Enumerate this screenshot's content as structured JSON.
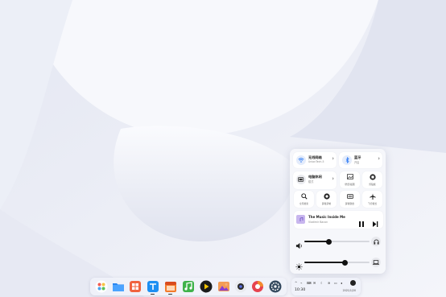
{
  "control_center": {
    "wifi": {
      "title": "无线网络",
      "subtitle": "UnionTech-5"
    },
    "bluetooth": {
      "title": "蓝牙",
      "subtitle": "开启"
    },
    "power": {
      "title": "电脑休闲",
      "subtitle": "模式"
    },
    "quick_tiles": [
      {
        "label": "壁纸/截图",
        "icon": "image-icon"
      },
      {
        "label": "剪贴板",
        "icon": "clipboard-icon"
      },
      {
        "label": "全局搜索",
        "icon": "search-icon"
      },
      {
        "label": "屏幕录制",
        "icon": "record-icon"
      },
      {
        "label": "屏幕键盘",
        "icon": "keyboard-icon"
      },
      {
        "label": "飞行模式",
        "icon": "airplane-icon"
      }
    ],
    "media": {
      "title": "The Music Inside Me",
      "artist": "Vladimir Bacon"
    },
    "volume": {
      "level": 0.38
    },
    "brightness": {
      "level": 0.62
    }
  },
  "dock": {
    "items": [
      "launcher-icon",
      "file-manager-icon",
      "app-store-icon",
      "installer-icon",
      "calendar-icon",
      "music-icon",
      "video-player-icon",
      "photos-icon",
      "camera-icon",
      "browser-icon",
      "settings-icon"
    ]
  },
  "tray": {
    "time": "10:30",
    "date": "2021/1/20"
  },
  "colors": {
    "accent": "#2f7cf6",
    "panel": "#f6f7fb"
  }
}
